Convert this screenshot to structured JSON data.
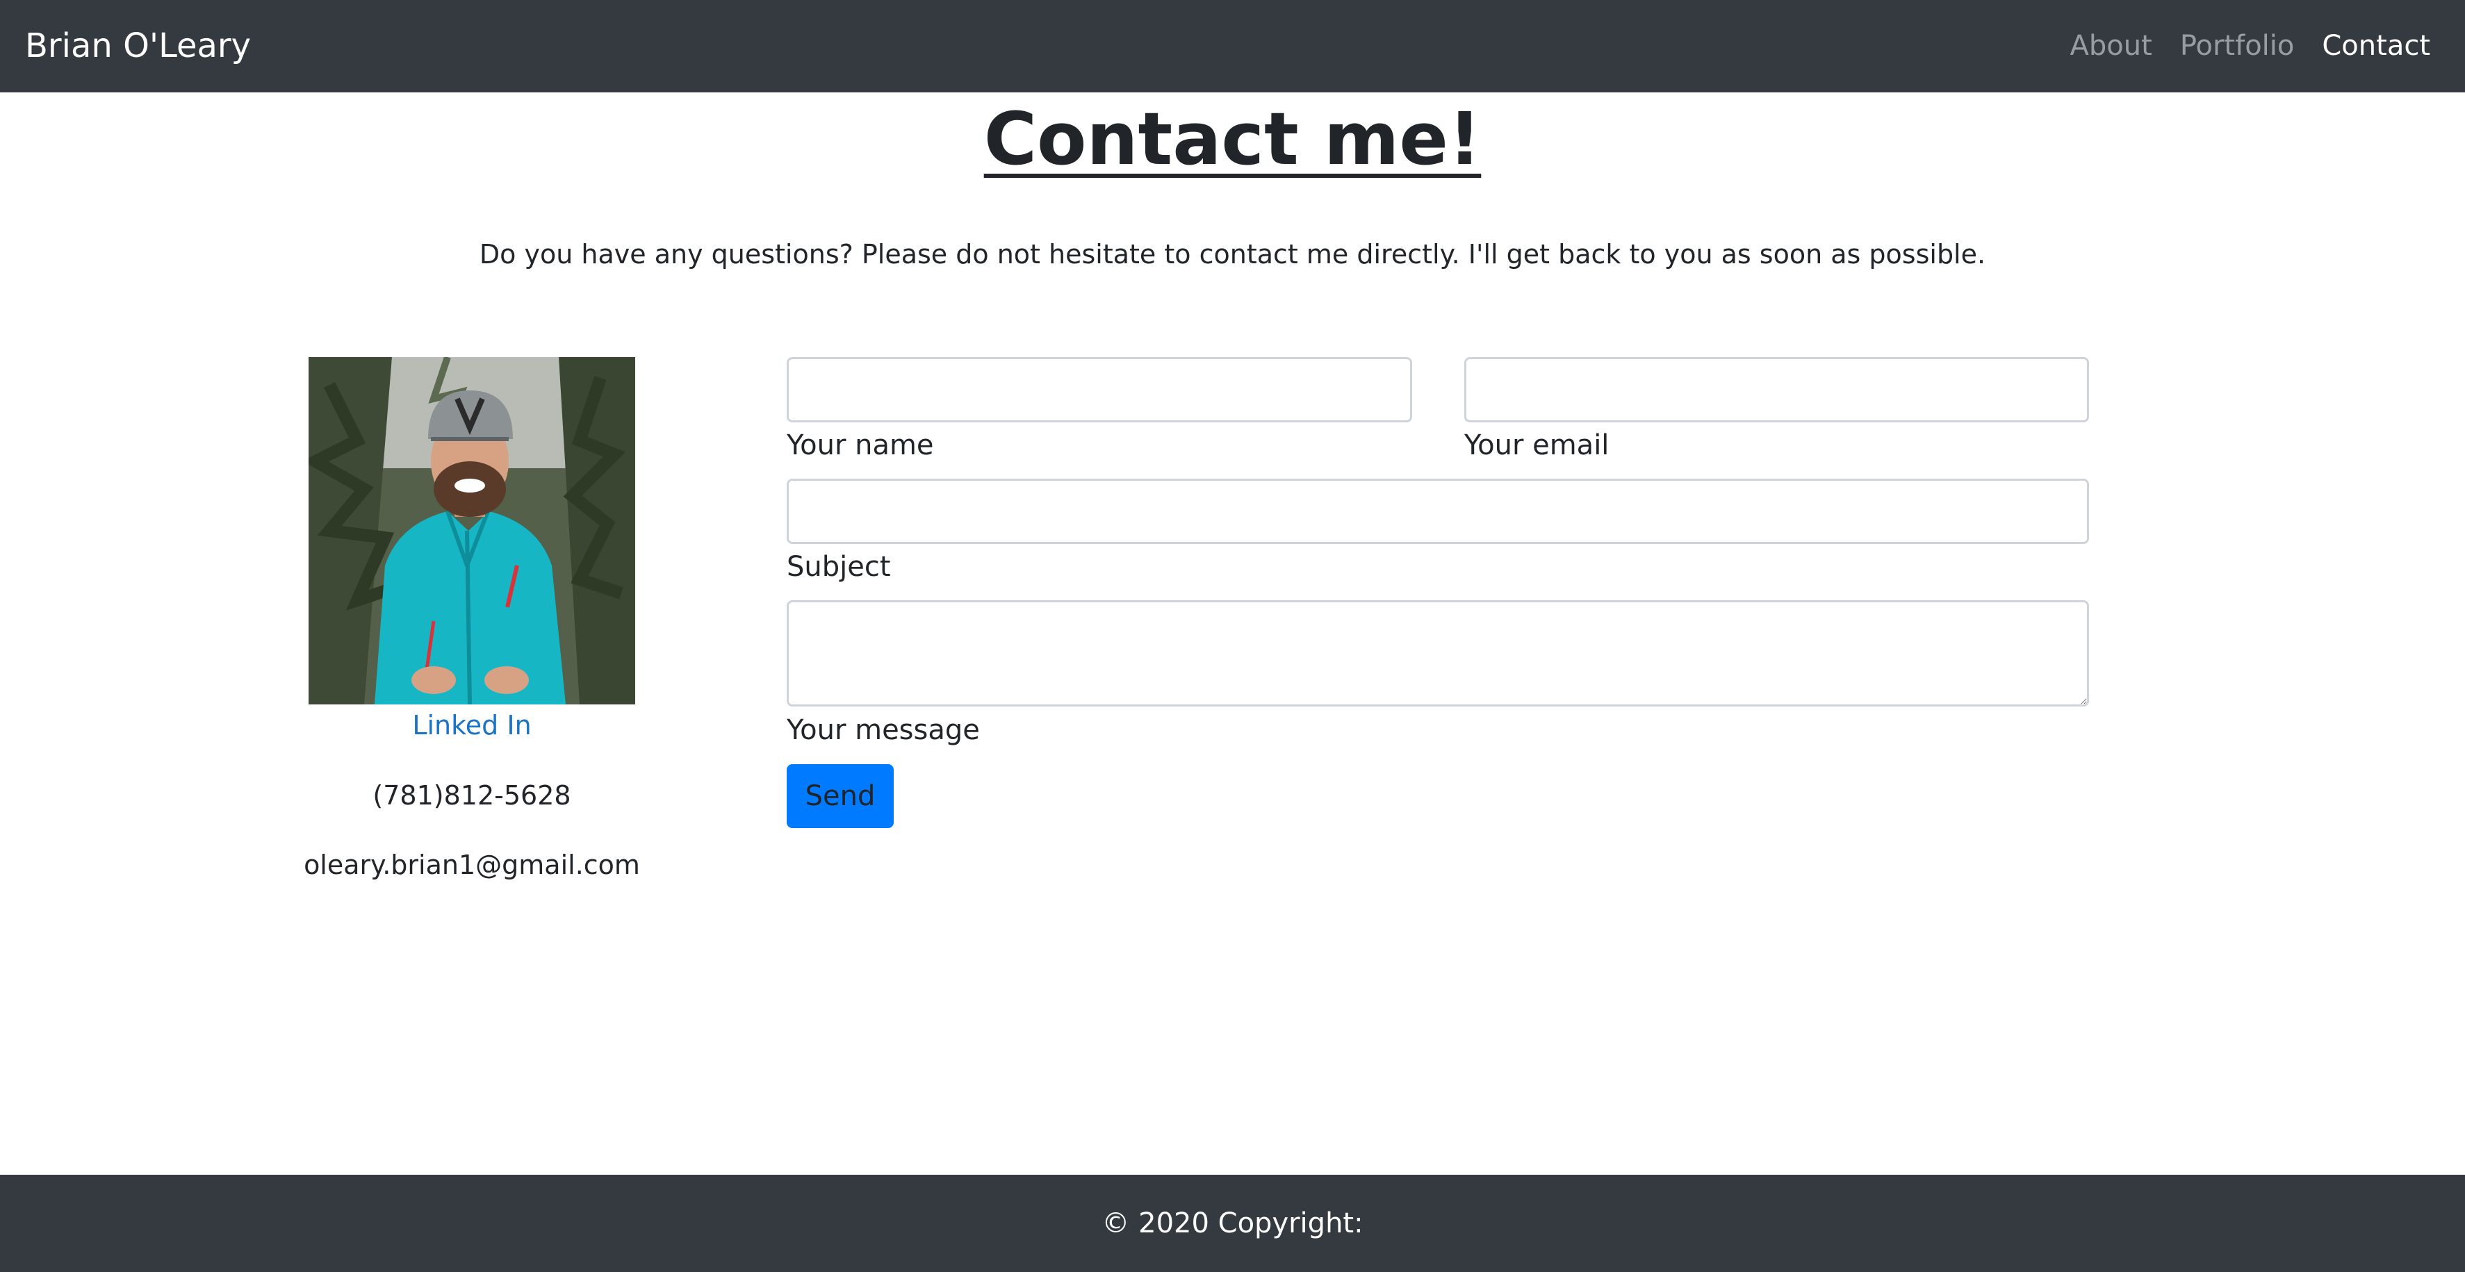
{
  "navbar": {
    "brand": "Brian O'Leary",
    "links": [
      {
        "label": "About",
        "active": false
      },
      {
        "label": "Portfolio",
        "active": false
      },
      {
        "label": "Contact",
        "active": true
      }
    ]
  },
  "main": {
    "title": "Contact me!",
    "intro": "Do you have any questions? Please do not hesitate to contact me directly. I'll get back to you as soon as possible."
  },
  "contact": {
    "photo_icon": "profile-photo",
    "linkedin_label": "Linked In",
    "phone": "(781)812-5628",
    "email": "oleary.brian1@gmail.com"
  },
  "form": {
    "name_value": "",
    "name_label": "Your name",
    "email_value": "",
    "email_label": "Your email",
    "subject_value": "",
    "subject_label": "Subject",
    "message_value": "",
    "message_label": "Your message",
    "send_label": "Send"
  },
  "footer": {
    "copyright": "© 2020 Copyright:"
  },
  "colors": {
    "navbar_bg": "#343a40",
    "primary_button": "#007bff",
    "link": "#1a73c4",
    "jacket": "#17b6c4"
  }
}
